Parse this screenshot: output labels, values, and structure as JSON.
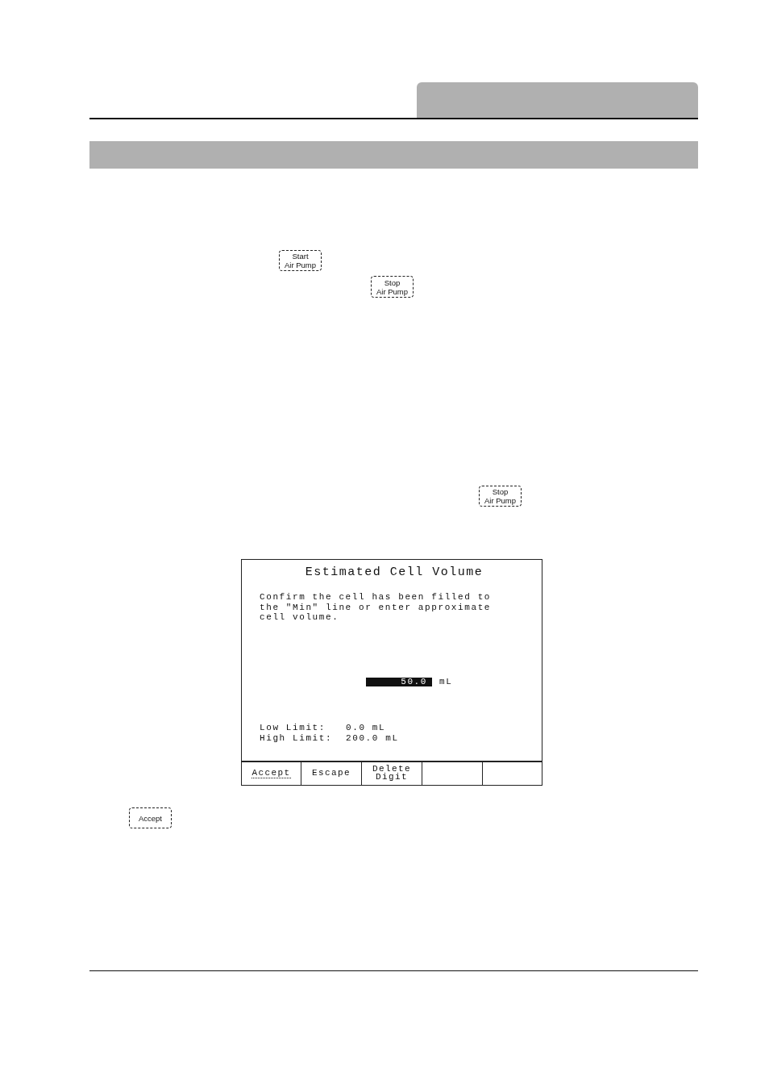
{
  "keys": [
    {
      "lines": [
        "Start",
        "Air Pump"
      ]
    },
    {
      "lines": [
        "Stop",
        "Air Pump"
      ]
    },
    {
      "lines": [
        "Stop",
        "Air Pump"
      ]
    }
  ],
  "screen": {
    "title": "Estimated Cell Volume",
    "message": "Confirm the cell has been filled to the \"Min\" line or enter approximate cell volume.",
    "entry": {
      "value": "50.0",
      "unit": "mL"
    },
    "limits": [
      {
        "label": "Low Limit:",
        "value": "0.0 mL"
      },
      {
        "label": "High Limit:",
        "value": "200.0 mL"
      }
    ],
    "softkeys": [
      {
        "lines": [
          "Accept"
        ],
        "selected": true
      },
      {
        "lines": [
          "Escape"
        ],
        "selected": false
      },
      {
        "lines": [
          "Delete",
          "Digit"
        ],
        "selected": false
      },
      {
        "selected": false
      },
      {
        "selected": false
      }
    ]
  },
  "accept_key": {
    "lines": [
      "Accept"
    ]
  }
}
